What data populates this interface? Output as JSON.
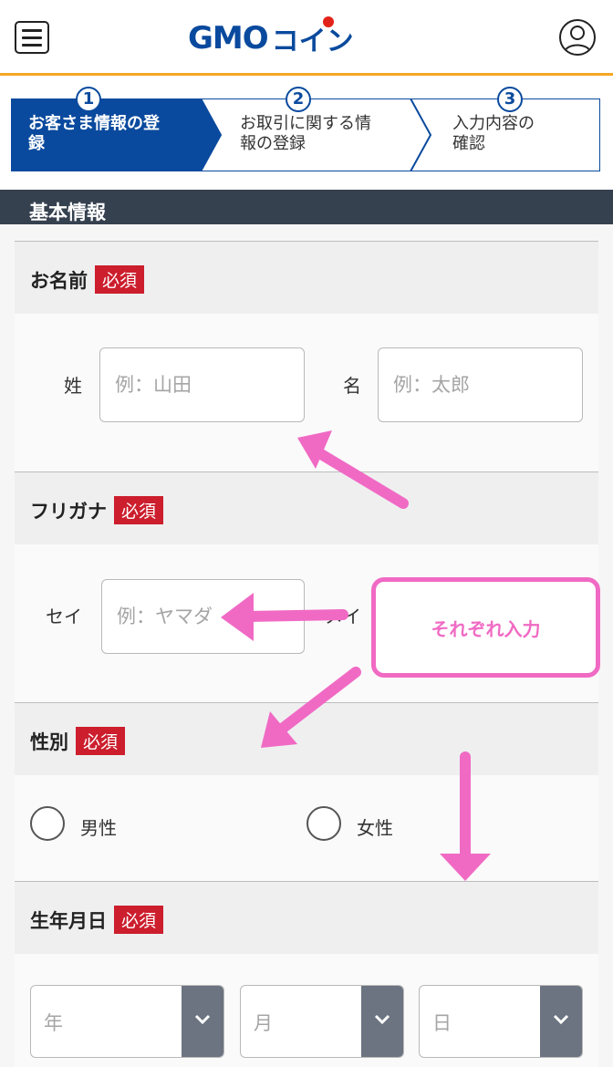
{
  "header": {
    "logo_gmo": "GMO",
    "logo_coin": "コイン"
  },
  "steps": [
    {
      "num": "1",
      "line1": "お客さま情報の登",
      "line2": "録"
    },
    {
      "num": "2",
      "line1": "お取引に関する情",
      "line2": "報の登録"
    },
    {
      "num": "3",
      "line1": "入力内容の",
      "line2": "確認"
    }
  ],
  "section_title": "基本情報",
  "required_label": "必須",
  "name": {
    "label": "お名前",
    "last_label": "姓",
    "last_placeholder": "例：山田",
    "first_label": "名",
    "first_placeholder": "例：太郎"
  },
  "kana": {
    "label": "フリガナ",
    "last_label": "セイ",
    "last_placeholder": "例：ヤマダ",
    "first_label": "メイ"
  },
  "gender": {
    "label": "性別",
    "options": [
      "男性",
      "女性"
    ]
  },
  "birthday": {
    "label": "生年月日",
    "year": "年",
    "month": "月",
    "day": "日"
  },
  "annotation": {
    "text": "それぞれ入力",
    "color": "#f06ac4"
  },
  "colors": {
    "brand": "#0a4a9e",
    "header_border": "#f5a623",
    "required_badge": "#cc1e2d",
    "section_bar": "#364150"
  }
}
